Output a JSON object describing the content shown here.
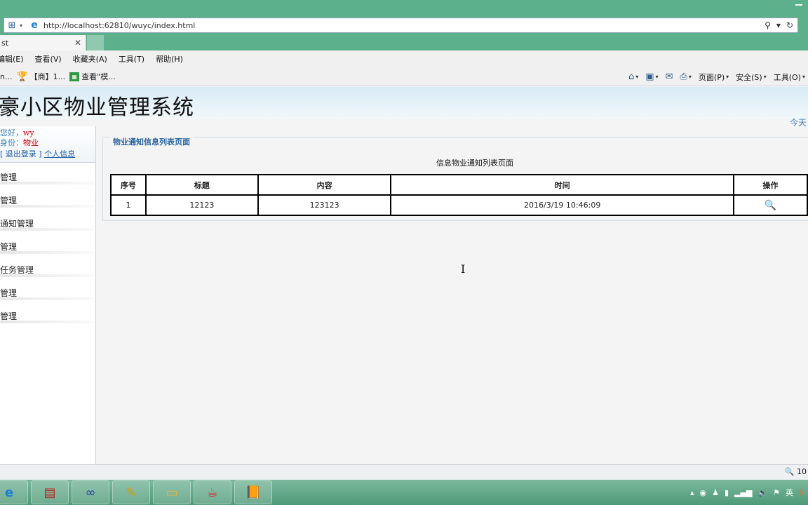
{
  "browser": {
    "url": "http://localhost:62810/wuyc/index.html",
    "tab_title": "st",
    "menu": [
      "编辑(E)",
      "查看(V)",
      "收藏夹(A)",
      "工具(T)",
      "帮助(H)"
    ],
    "menu_first_partial": "编辑(E)",
    "favorites": [
      {
        "label": "n..."
      },
      {
        "label": "【商】1..."
      },
      {
        "label": "查看\"模..."
      }
    ],
    "commands": [
      "页面(P)",
      "安全(S)",
      "工具(O)"
    ],
    "zoom": "10"
  },
  "header": {
    "title": "豪小区物业管理系统",
    "today": "今天"
  },
  "user": {
    "greeting_key": "您好，",
    "greeting_value": "wy",
    "role_key": "身份：",
    "role_value": "物业",
    "logout": "退出登录",
    "profile": "个人信息",
    "links_prefix": "[",
    "links_sep": "]"
  },
  "sidebar": {
    "items": [
      {
        "label": "管理"
      },
      {
        "label": "管理"
      },
      {
        "label": "通知管理"
      },
      {
        "label": "管理"
      },
      {
        "label": "任务管理"
      },
      {
        "label": "管理"
      },
      {
        "label": "管理"
      }
    ]
  },
  "main": {
    "legend": "物业通知信息列表页面",
    "caption": "信息物业通知列表页面",
    "columns": [
      "序号",
      "标题",
      "内容",
      "时间",
      "操作"
    ],
    "rows": [
      {
        "index": "1",
        "title": "12123",
        "content": "123123",
        "time": "2016/3/19 10:46:09"
      }
    ]
  },
  "taskbar": {
    "tray_lang": "英"
  }
}
